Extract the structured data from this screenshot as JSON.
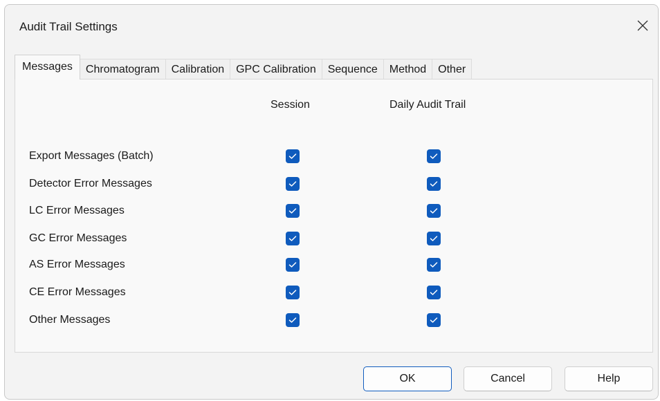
{
  "window": {
    "title": "Audit Trail Settings"
  },
  "tabs": [
    {
      "label": "Messages",
      "active": true
    },
    {
      "label": "Chromatogram"
    },
    {
      "label": "Calibration"
    },
    {
      "label": "GPC Calibration"
    },
    {
      "label": "Sequence"
    },
    {
      "label": "Method"
    },
    {
      "label": "Other"
    }
  ],
  "columns": {
    "session": "Session",
    "daily": "Daily Audit Trail"
  },
  "rows": [
    {
      "label": "Export Messages (Batch)",
      "session": true,
      "daily": true
    },
    {
      "label": "Detector Error Messages",
      "session": true,
      "daily": true
    },
    {
      "label": "LC Error Messages",
      "session": true,
      "daily": true
    },
    {
      "label": "GC Error Messages",
      "session": true,
      "daily": true
    },
    {
      "label": "AS Error Messages",
      "session": true,
      "daily": true
    },
    {
      "label": "CE Error Messages",
      "session": true,
      "daily": true
    },
    {
      "label": "Other Messages",
      "session": true,
      "daily": true
    }
  ],
  "buttons": {
    "ok": "OK",
    "cancel": "Cancel",
    "help": "Help"
  },
  "colors": {
    "accent": "#0f5bbd"
  },
  "icons": {
    "close": "close-icon",
    "check": "checkmark-icon"
  }
}
